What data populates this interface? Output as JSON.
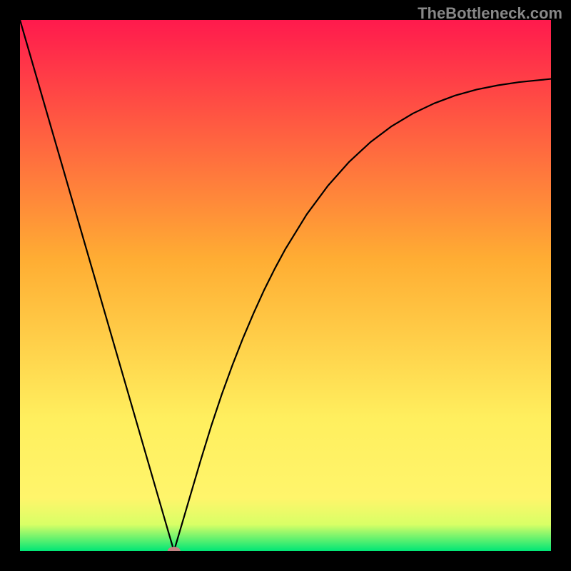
{
  "watermark": "TheBottleneck.com",
  "chart_data": {
    "type": "line",
    "title": "",
    "xlabel": "",
    "ylabel": "",
    "x_range": [
      0,
      100
    ],
    "y_range": [
      0,
      100
    ],
    "series": [
      {
        "name": "bottleneck-curve",
        "x": [
          0,
          2,
          4,
          6,
          8,
          10,
          12,
          14,
          16,
          18,
          20,
          22,
          24,
          26,
          28,
          29,
          30,
          31,
          32,
          33,
          34,
          36,
          38,
          40,
          42,
          44,
          46,
          48,
          50,
          54,
          58,
          62,
          66,
          70,
          74,
          78,
          82,
          86,
          90,
          94,
          98,
          100
        ],
        "y": [
          100,
          93.1,
          86.2,
          79.3,
          72.4,
          65.5,
          58.6,
          51.7,
          44.8,
          37.9,
          31.0,
          24.1,
          17.2,
          10.3,
          3.4,
          0.0,
          3.4,
          6.8,
          10.2,
          13.6,
          17.0,
          23.5,
          29.5,
          35.0,
          40.1,
          44.8,
          49.2,
          53.2,
          56.9,
          63.4,
          68.8,
          73.3,
          77.0,
          80.0,
          82.4,
          84.3,
          85.8,
          86.9,
          87.7,
          88.3,
          88.7,
          88.9
        ]
      }
    ],
    "marker": {
      "name": "optimal-point",
      "x": 29,
      "y": 0,
      "color": "#c38383"
    },
    "background": {
      "type": "vertical-gradient",
      "stops": [
        {
          "pos": 0.0,
          "color": "#ff1a4d"
        },
        {
          "pos": 0.45,
          "color": "#ffad33"
        },
        {
          "pos": 0.75,
          "color": "#ffef5e"
        },
        {
          "pos": 0.9,
          "color": "#fff56b"
        },
        {
          "pos": 0.95,
          "color": "#d9ff66"
        },
        {
          "pos": 1.0,
          "color": "#00e676"
        }
      ]
    },
    "grid": false,
    "legend": false
  }
}
